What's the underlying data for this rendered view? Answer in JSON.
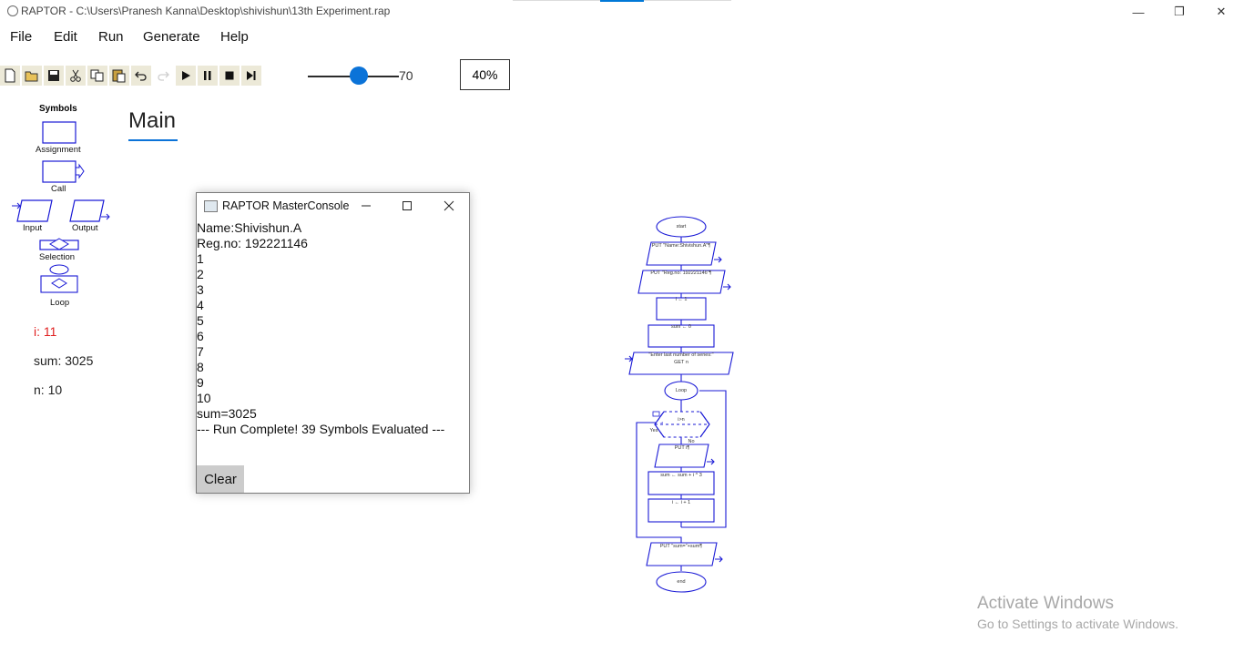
{
  "window": {
    "title": "RAPTOR - C:\\Users\\Pranesh Kanna\\Desktop\\shivishun\\13th Experiment.rap",
    "minimize_glyph": "—",
    "restore_glyph": "❐",
    "close_glyph": "✕"
  },
  "menu": [
    "File",
    "Edit",
    "Run",
    "Generate",
    "Help"
  ],
  "toolbar": {
    "icons": [
      "new-icon",
      "open-icon",
      "save-icon",
      "cut-icon",
      "copy-icon",
      "paste-icon",
      "undo-icon",
      "redo-icon",
      "run-icon",
      "pause-icon",
      "stop-icon",
      "step-icon"
    ],
    "speed_value": "70",
    "speed_level": 0.7,
    "zoom": "40%"
  },
  "symbols": {
    "title": "Symbols",
    "items": [
      "Assignment",
      "Call",
      "Input",
      "Output",
      "Selection",
      "Loop"
    ]
  },
  "variables": [
    {
      "text": "i: 11",
      "color": "#e02020"
    },
    {
      "text": "sum: 3025",
      "color": "#222222"
    },
    {
      "text": "n: 10",
      "color": "#222222"
    }
  ],
  "main_tab": "Main",
  "console": {
    "title": "RAPTOR MasterConsole",
    "lines": [
      "Name:Shivishun.A",
      "Reg.no: 192221146",
      "1",
      "2",
      "3",
      "4",
      "5",
      "6",
      "7",
      "8",
      "9",
      "10",
      "sum=3025",
      "--- Run Complete!  39 Symbols Evaluated ---"
    ],
    "clear_label": "Clear"
  },
  "flowchart": {
    "start": "start",
    "put_name": "PUT \"Name:Shivishun.A\"¶",
    "put_reg": "PUT \"Reg.no: 192221146\"¶",
    "assign_i": "i ← 1",
    "assign_sum": "sum ← 0",
    "input_prompt": "\"Enter last number of series:\"",
    "input_var": "GET n",
    "loop": "Loop",
    "condition": "i>n",
    "yes": "Yes",
    "no": "No",
    "put_i": "PUT i¶",
    "sum_update": "sum ← sum + i ^ 3",
    "i_update": "i ← i + 1",
    "put_sum": "PUT \"sum=\"+sum¶",
    "end": "end"
  },
  "colors": {
    "accent": "#0b73d8",
    "symbol_stroke": "#1a1ad6",
    "current_var": "#e02020"
  },
  "activation": {
    "title": "Activate Windows",
    "subtitle": "Go to Settings to activate Windows."
  }
}
